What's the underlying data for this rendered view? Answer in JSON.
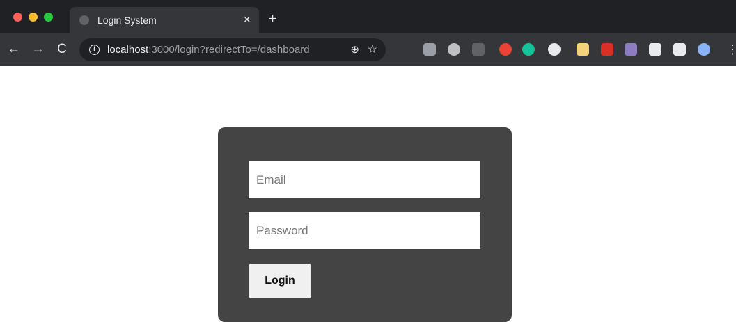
{
  "browser": {
    "tab_title": "Login System",
    "tab_close": "×",
    "new_tab": "+",
    "url_host": "localhost",
    "url_rest": ":3000/login?redirectTo=/dashboard",
    "back_icon": "←",
    "forward_icon": "→",
    "reload_icon": "C",
    "info_icon": "i",
    "zoom_icon": "⊕",
    "star_icon": "☆",
    "menu_icon": "⋮",
    "extensions": [
      {
        "name": "ext-gray-square-icon",
        "color": "#9aa0a6"
      },
      {
        "name": "ext-target-icon",
        "color": "#bdc1c6"
      },
      {
        "name": "ext-signal-icon",
        "color": "#5f6368"
      },
      {
        "name": "ext-red-shield-icon",
        "color": "#ea4335"
      },
      {
        "name": "ext-green-circle-icon",
        "color": "#15c39a"
      },
      {
        "name": "ext-s-icon",
        "color": "#e8eaed"
      },
      {
        "name": "ext-pencil-icon",
        "color": "#f3d27a"
      },
      {
        "name": "ext-red-icon",
        "color": "#d93025"
      },
      {
        "name": "ext-purple-icon",
        "color": "#8e7cc3"
      },
      {
        "name": "extensions-puzzle-icon",
        "color": "#e8eaed"
      },
      {
        "name": "reading-list-icon",
        "color": "#e8eaed"
      },
      {
        "name": "profile-avatar-icon",
        "color": "#8ab4f8"
      }
    ]
  },
  "login": {
    "email_placeholder": "Email",
    "password_placeholder": "Password",
    "login_button": "Login"
  },
  "colors": {
    "card_background": "#444444",
    "page_background": "#ffffff",
    "tabbar": "#202124",
    "toolbar": "#35363a"
  }
}
